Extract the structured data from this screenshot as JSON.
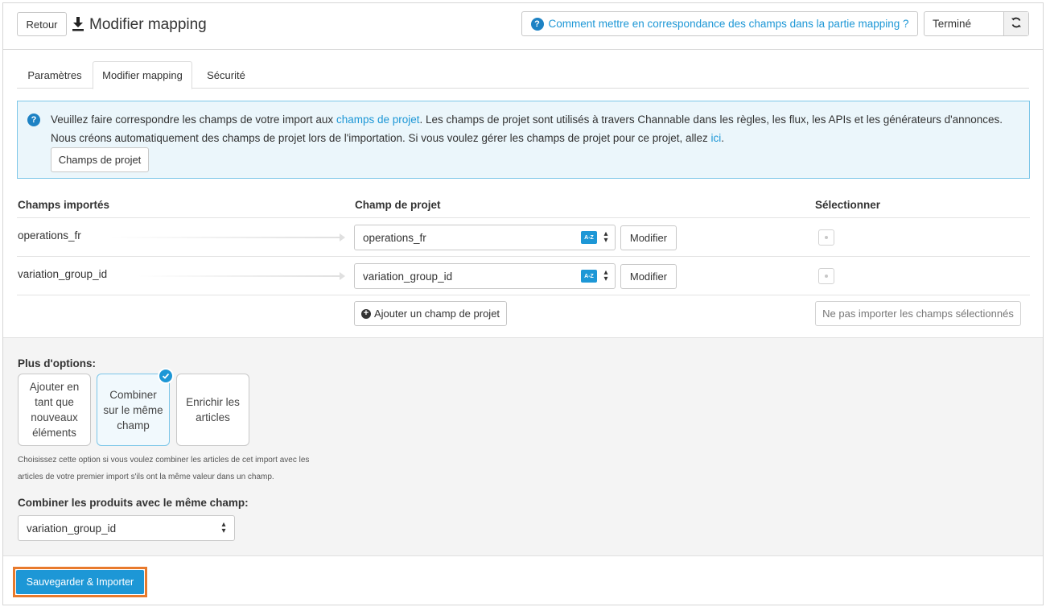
{
  "header": {
    "back_label": "Retour",
    "title": "Modifier mapping",
    "help_text": "Comment mettre en correspondance des champs dans la partie mapping ?",
    "status_text": "Terminé"
  },
  "tabs": [
    {
      "label": "Paramètres"
    },
    {
      "label": "Modifier mapping"
    },
    {
      "label": "Sécurité"
    }
  ],
  "info": {
    "text_1": "Veuillez faire correspondre les champs de votre import aux ",
    "link_1": "champs de projet",
    "text_2": ". Les champs de projet sont utilisés à travers Channable dans les règles, les flux, les APIs et les générateurs d'annonces.",
    "text_3": "Nous créons automatiquement des champs de projet lors de l'importation. Si vous voulez gérer les champs de projet pour ce projet, allez ",
    "link_2": "ici",
    "text_4": ".",
    "button_label": "Champs de projet"
  },
  "table": {
    "headers": {
      "imported": "Champs importés",
      "project": "Champ de projet",
      "select": "Sélectionner"
    },
    "rows": [
      {
        "imported": "operations_fr",
        "project_field": "operations_fr",
        "modify_label": "Modifier",
        "az_label": "A-Z"
      },
      {
        "imported": "variation_group_id",
        "project_field": "variation_group_id",
        "modify_label": "Modifier",
        "az_label": "A-Z"
      }
    ],
    "add_label": "Ajouter un champ de projet",
    "no_import_label": "Ne pas importer les champs sélectionnés"
  },
  "options": {
    "title": "Plus d'options:",
    "cards": [
      {
        "label": "Ajouter en tant que nouveaux éléments",
        "selected": false
      },
      {
        "label": "Combiner sur le même champ",
        "selected": true
      },
      {
        "label": "Enrichir les articles",
        "selected": false
      }
    ],
    "description_1": "Choisissez cette option si vous voulez combiner les articles de cet import avec les",
    "description_2": "articles de votre premier import s'ils ont la même valeur dans un champ.",
    "combine_label": "Combiner les produits avec le même champ:",
    "combine_value": "variation_group_id"
  },
  "footer": {
    "save_label": "Sauvegarder & Importer"
  },
  "colors": {
    "accent": "#1d97d6",
    "highlight": "#e87a2c",
    "info_bg": "#ebf6fb"
  }
}
